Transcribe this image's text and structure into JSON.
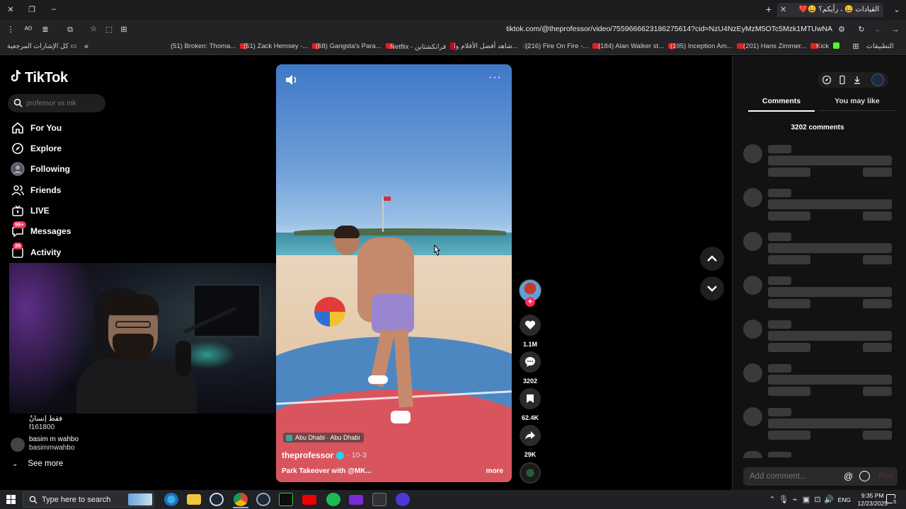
{
  "browser": {
    "tab_title": "القيادات 😀 ، رأيكم؟ 😀❤️",
    "url": "tiktok.com/@theprofessor/video/7559666623186275614?cid=NzU4NzEyMzM5OTc5Mzk1MTUwNA",
    "bookmarks": [
      "(51) Broken: Thoma...",
      "(51) Zack Hemsey -...",
      "(68) Gangsta's Para...",
      "Netflix - فرانكشتاين",
      "شاهد أفضل الأفلام وا...",
      "(216) Fire On Fire -...",
      "(184) Alan Walker st...",
      "(195) Inception Am...",
      "(201) Hans Zimmer...",
      "Kick"
    ],
    "bookmarks_left_label": "كل الإشارات المرجعية",
    "bookmarks_right_label": "التطبيقات"
  },
  "tiktok": {
    "logo": "TikTok",
    "search_placeholder": "professor vs mk",
    "nav": [
      {
        "label": "For You",
        "icon": "home-icon"
      },
      {
        "label": "Explore",
        "icon": "compass-icon"
      },
      {
        "label": "Following",
        "icon": "following-avatar-icon"
      },
      {
        "label": "Friends",
        "icon": "friends-icon"
      },
      {
        "label": "LIVE",
        "icon": "live-icon"
      },
      {
        "label": "Messages",
        "icon": "messages-icon",
        "badge": "99+"
      },
      {
        "label": "Activity",
        "icon": "activity-icon",
        "badge": "26"
      }
    ],
    "following_accounts": [
      {
        "name": "فقط إنسانٌ",
        "handle": "f161800"
      },
      {
        "name": "basim m wahbo",
        "handle": "basimmwahbo"
      }
    ],
    "see_more": "See more"
  },
  "video": {
    "location": "Abu Dhabi · Abu Dhabi",
    "author": "theprofessor",
    "date": "· 10-3",
    "description": "Park Takeover with @MK...",
    "more": "more"
  },
  "actions": {
    "likes": "1.1M",
    "comments": "3202",
    "saves": "62.4K",
    "shares": "29K"
  },
  "panel": {
    "tab_comments": "Comments",
    "tab_you_may_like": "You may like",
    "comment_count": "3202 comments",
    "add_comment_placeholder": "Add comment...",
    "post": "Post"
  },
  "taskbar": {
    "search_text": "Type here to search",
    "language": "ENG",
    "time": "9:35 PM",
    "date": "12/23/2025",
    "notifications": "5"
  },
  "colors": {
    "accent": "#fe2c55",
    "verified": "#20d5ec",
    "background": "#000000",
    "panel": "#121212"
  }
}
